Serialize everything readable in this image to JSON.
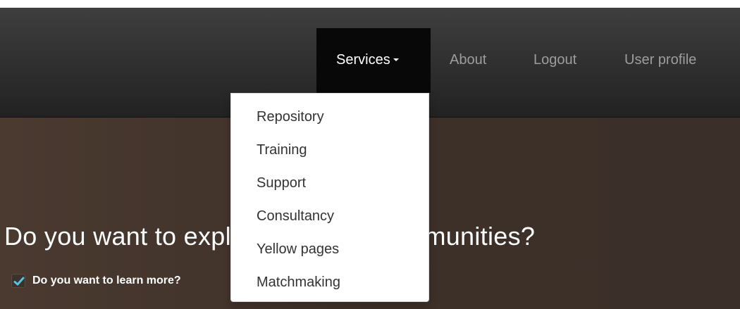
{
  "navbar": {
    "items": [
      {
        "label": "Services",
        "active": true,
        "has_caret": true
      },
      {
        "label": "About"
      },
      {
        "label": "Logout"
      },
      {
        "label": "User profile"
      }
    ]
  },
  "dropdown": {
    "items": [
      {
        "label": "Repository"
      },
      {
        "label": "Training"
      },
      {
        "label": "Support"
      },
      {
        "label": "Consultancy"
      },
      {
        "label": "Yellow pages"
      },
      {
        "label": "Matchmaking"
      }
    ]
  },
  "hero": {
    "title": "Do you want to explore different communities?",
    "checkbox_label": "Do you want to learn more?",
    "checkbox_checked": true
  },
  "colors": {
    "navbar_bg": "#2b2b2b",
    "navbar_active_bg": "#080808",
    "nav_text": "#9d9d9d",
    "hero_bg": "#3e3029",
    "checkmark": "#5bc0de"
  }
}
